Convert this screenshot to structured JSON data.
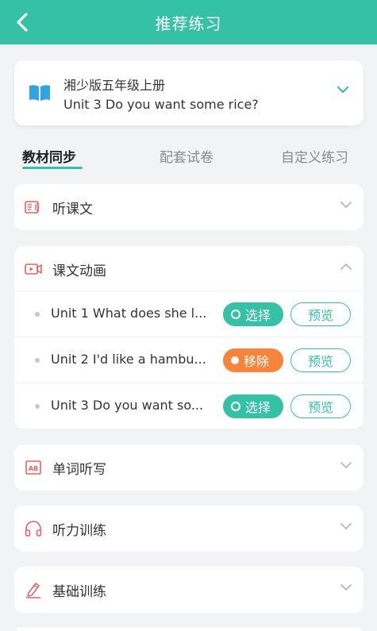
{
  "header": {
    "title": "推荐练习"
  },
  "book": {
    "edition": "湘少版五年级上册",
    "unit": "Unit 3 Do you want some rice?"
  },
  "tabs": [
    {
      "label": "教材同步",
      "active": true
    },
    {
      "label": "配套试卷",
      "active": false
    },
    {
      "label": "自定义练习",
      "active": false
    }
  ],
  "sections": {
    "listen_text": {
      "title": "听课文",
      "icon": "book-audio-icon",
      "expanded": false
    },
    "animation": {
      "title": "课文动画",
      "icon": "video-icon",
      "expanded": true,
      "units": [
        {
          "title": "Unit 1 What does she l...",
          "action": "选择",
          "action_state": "select",
          "preview": "预览"
        },
        {
          "title": "Unit 2 I'd like a hambu...",
          "action": "移除",
          "action_state": "remove",
          "preview": "预览"
        },
        {
          "title": "Unit 3 Do you want so...",
          "action": "选择",
          "action_state": "select",
          "preview": "预览"
        }
      ]
    },
    "dictation": {
      "title": "单词听写",
      "icon": "ab-icon",
      "expanded": false
    },
    "listening": {
      "title": "听力训练",
      "icon": "headphones-icon",
      "expanded": false
    },
    "basic": {
      "title": "基础训练",
      "icon": "pencil-icon",
      "expanded": false
    }
  },
  "colors": {
    "primary": "#35c1a5",
    "remove": "#f7843b",
    "icon_red": "#e9625f",
    "book_blue": "#2fa3e6"
  }
}
